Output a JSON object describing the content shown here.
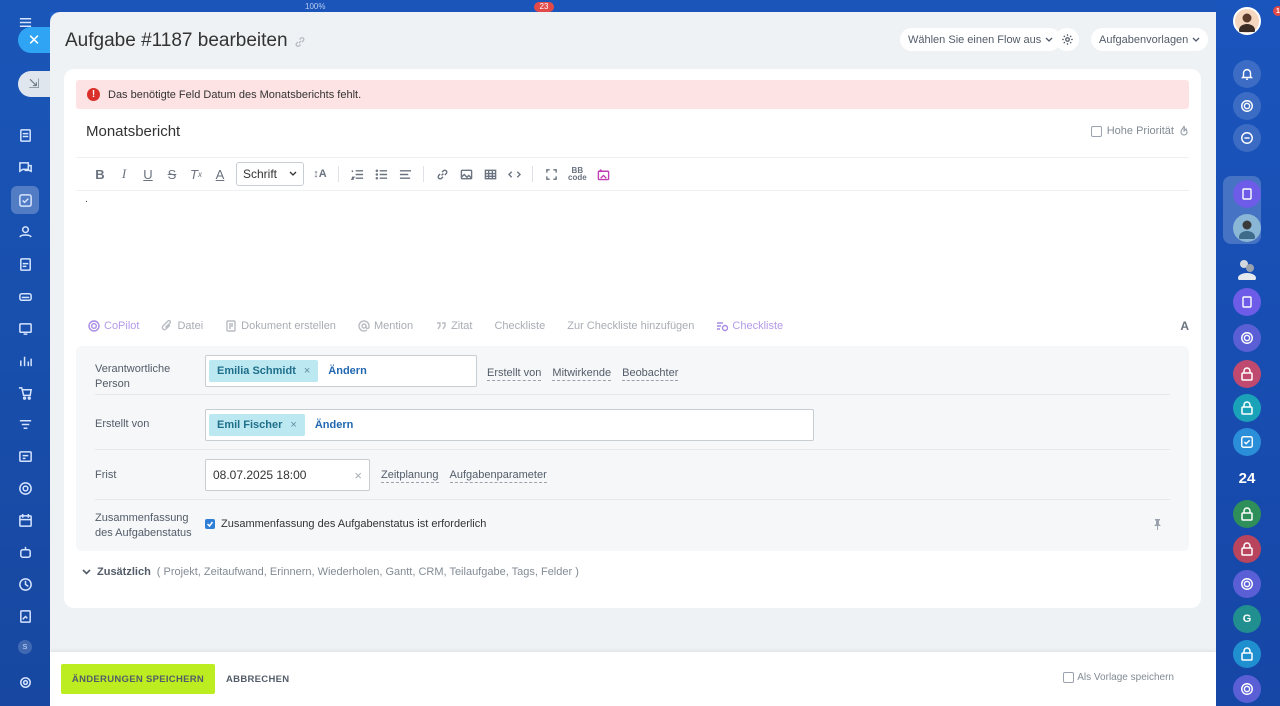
{
  "top_strip": {
    "percent": "100%",
    "count": "23"
  },
  "header": {
    "title": "Aufgabe #1187 bearbeiten",
    "flow_select": "Wählen Sie einen Flow aus",
    "templates": "Aufgabenvorlagen"
  },
  "alert": {
    "message": "Das benötigte Feld Datum des Monatsberichts fehlt."
  },
  "task": {
    "title": "Monatsbericht",
    "priority_label": "Hohe Priorität",
    "body_text": "."
  },
  "toolbar": {
    "font_select": "Schrift"
  },
  "actions": {
    "copilot": "CoPilot",
    "file": "Datei",
    "document": "Dokument erstellen",
    "mention": "Mention",
    "quote": "Zitat",
    "checklist": "Checkliste",
    "add_to_checklist": "Zur Checkliste hinzufügen",
    "checklist2": "Checkliste",
    "font_toggle": "A"
  },
  "fields": {
    "responsible": {
      "label": "Verantwortliche Person",
      "user": "Emilia Schmidt",
      "change": "Ändern",
      "links": [
        "Erstellt von",
        "Mitwirkende",
        "Beobachter"
      ]
    },
    "creator": {
      "label": "Erstellt von",
      "user": "Emil Fischer",
      "change": "Ändern"
    },
    "deadline": {
      "label": "Frist",
      "value": "08.07.2025 18:00",
      "links": [
        "Zeitplanung",
        "Aufgabenparameter"
      ]
    },
    "summary": {
      "label": "Zusammenfassung des Aufgabenstatus",
      "checkbox_label": "Zusammenfassung des Aufgabenstatus ist erforderlich"
    }
  },
  "additional": {
    "label": "Zusätzlich",
    "items": "( Projekt,  Zeitaufwand,  Erinnern,  Wiederholen,  Gantt,  CRM,  Teilaufgabe,  Tags,  Felder )"
  },
  "footer": {
    "save": "ÄNDERUNGEN SPEICHERN",
    "cancel": "ABBRECHEN",
    "save_template": "Als Vorlage speichern"
  },
  "right_rail": {
    "count_24": "24",
    "g_letter": "G",
    "notification_count": "1"
  },
  "left_rail": {
    "s_letter": "S"
  },
  "colors": {
    "accent": "#2fa4f5",
    "save": "#bbed21",
    "chip": "#bce8f1",
    "alert_bg": "#fde3e3",
    "rail": "#1a56b8"
  }
}
